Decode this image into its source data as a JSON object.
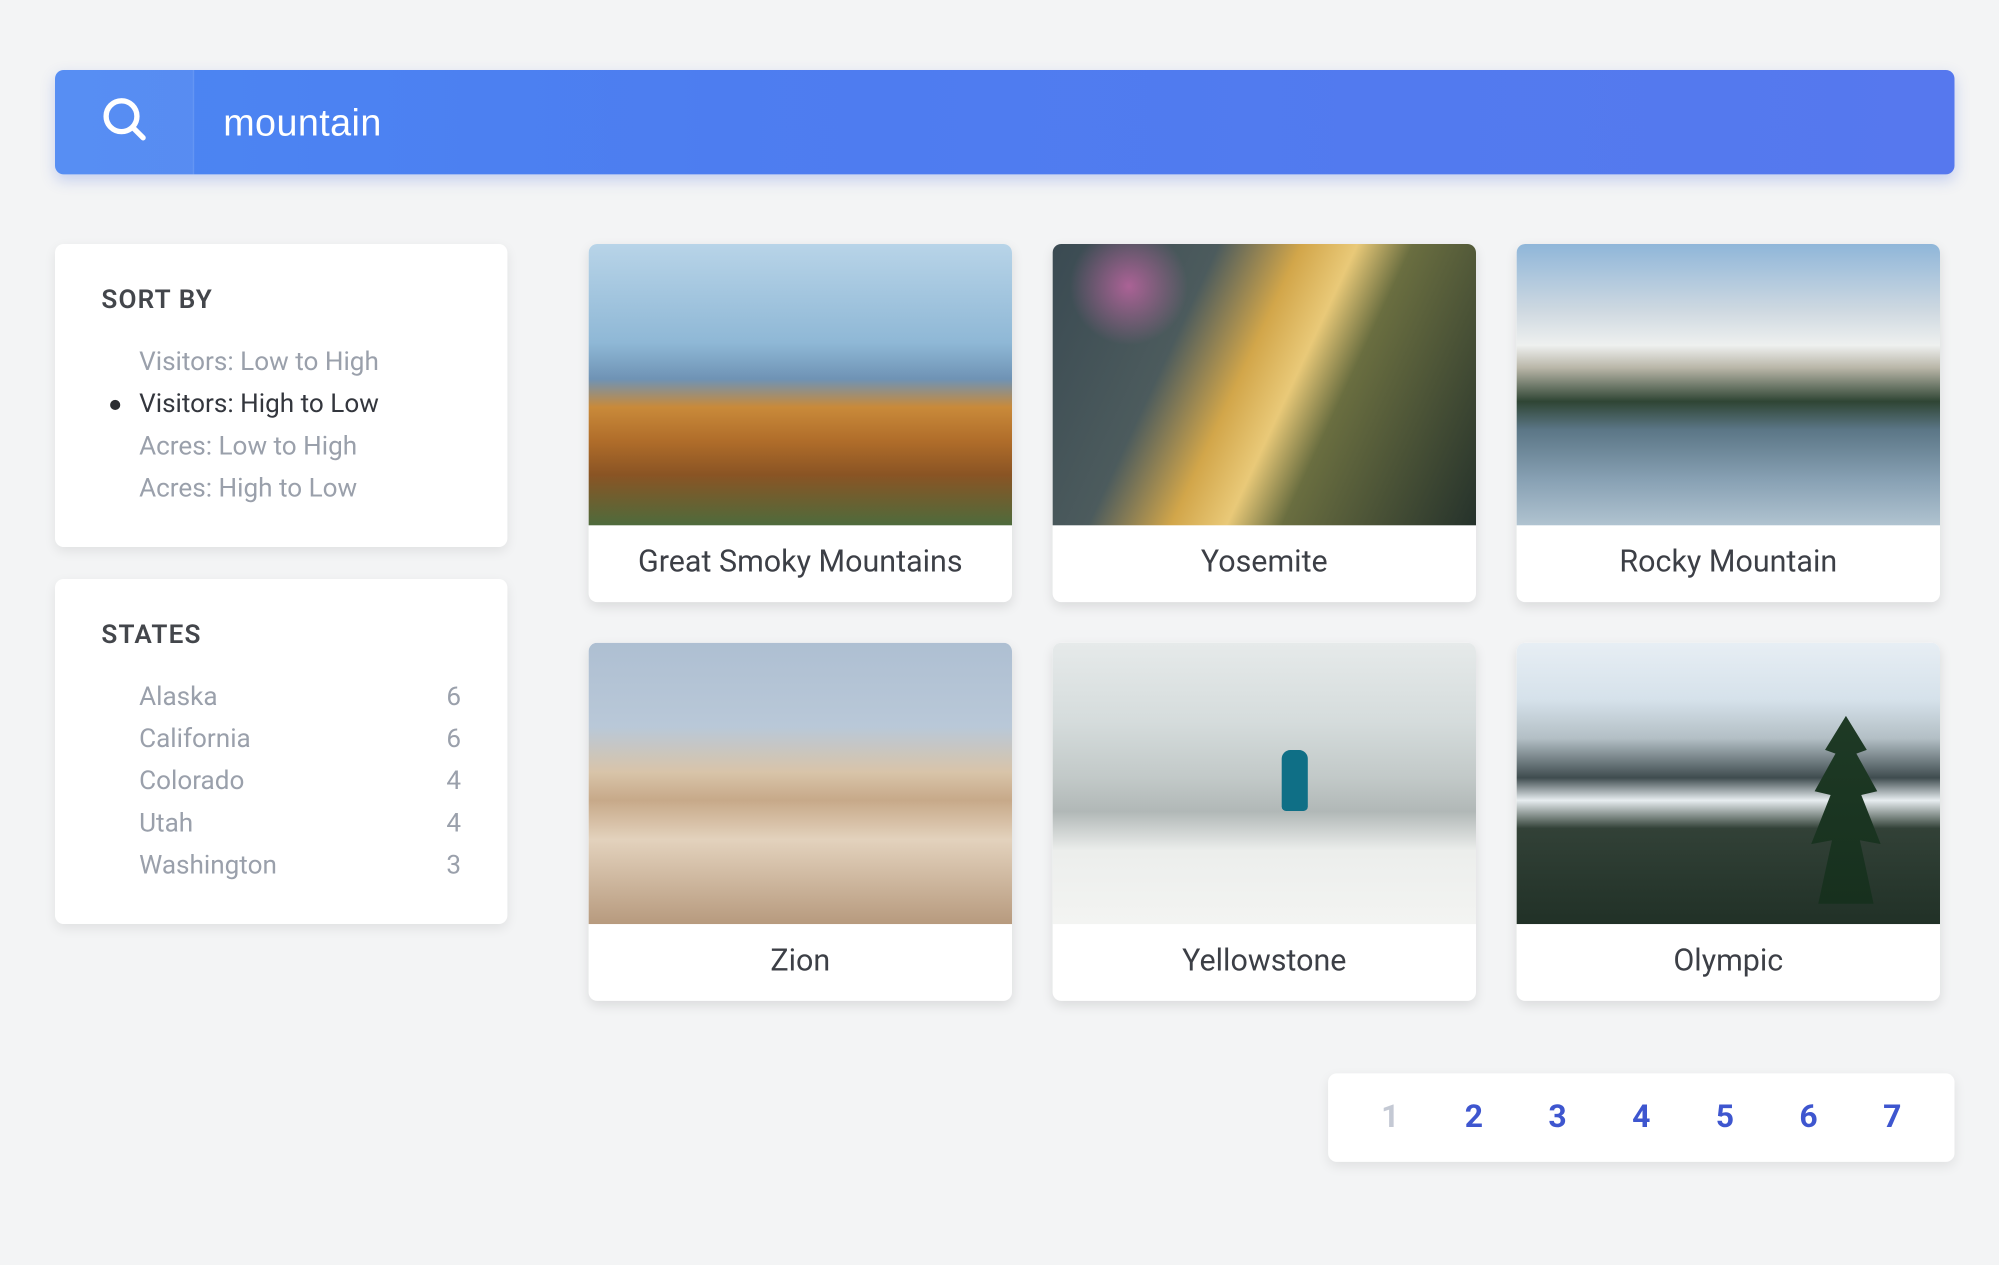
{
  "search": {
    "value": "mountain",
    "placeholder": "Search"
  },
  "sidebar": {
    "sort": {
      "title": "SORT BY",
      "selected_index": 1,
      "options": [
        "Visitors: Low to High",
        "Visitors: High to Low",
        "Acres: Low to High",
        "Acres: High to Low"
      ]
    },
    "states": {
      "title": "STATES",
      "items": [
        {
          "name": "Alaska",
          "count": "6"
        },
        {
          "name": "California",
          "count": "6"
        },
        {
          "name": "Colorado",
          "count": "4"
        },
        {
          "name": "Utah",
          "count": "4"
        },
        {
          "name": "Washington",
          "count": "3"
        }
      ]
    }
  },
  "results": [
    {
      "title": "Great Smoky Mountains",
      "img_class": "img-smoky"
    },
    {
      "title": "Yosemite",
      "img_class": "img-yosemite"
    },
    {
      "title": "Rocky Mountain",
      "img_class": "img-rocky"
    },
    {
      "title": "Zion",
      "img_class": "img-zion"
    },
    {
      "title": "Yellowstone",
      "img_class": "img-yellowstone"
    },
    {
      "title": "Olympic",
      "img_class": "img-olympic"
    }
  ],
  "pagination": {
    "current": "1",
    "pages": [
      "1",
      "2",
      "3",
      "4",
      "5",
      "6",
      "7"
    ]
  }
}
